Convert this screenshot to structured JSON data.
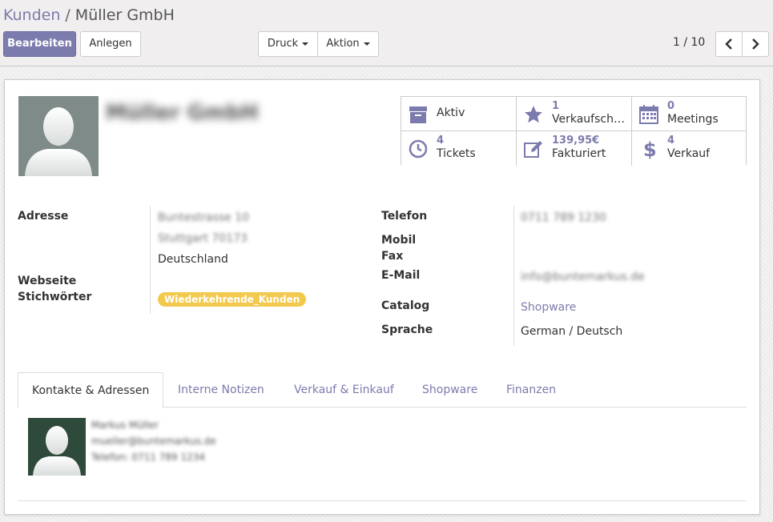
{
  "breadcrumb": {
    "parent": "Kunden",
    "separator": "/",
    "current": "Müller GmbH"
  },
  "toolbar": {
    "edit_label": "Bearbeiten",
    "create_label": "Anlegen",
    "print_label": "Druck",
    "action_label": "Aktion"
  },
  "pager": {
    "value": "1 / 10",
    "prev_icon": "‹",
    "next_icon": "›"
  },
  "partner": {
    "name": "Müller GmbH"
  },
  "stat_buttons": {
    "active": {
      "label": "Aktiv",
      "icon": "archive-icon"
    },
    "purchases": {
      "count": "1",
      "label": "Verkaufschancen",
      "icon": "star-icon"
    },
    "meetings": {
      "count": "0",
      "label": "Meetings",
      "icon": "calendar-icon"
    },
    "tickets": {
      "count": "4",
      "label": "Tickets",
      "icon": "clock-icon"
    },
    "invoiced": {
      "amount": "139,95€",
      "label": "Fakturiert",
      "icon": "edit-icon"
    },
    "sales": {
      "count": "4",
      "label": "Verkauf",
      "icon": "dollar-icon"
    }
  },
  "fields_left": {
    "address_label": "Adresse",
    "street": "Buntestrasse 10",
    "city": "Stuttgart 70173",
    "country": "Deutschland",
    "website_label": "Webseite",
    "tags_label": "Stichwörter",
    "tag": "Wiederkehrende_Kunden"
  },
  "fields_right": {
    "phone_label": "Telefon",
    "phone": "0711 789 1230",
    "mobile_label": "Mobil",
    "fax_label": "Fax",
    "email_label": "E-Mail",
    "email": "info@buntemarkus.de",
    "catalog_label": "Catalog",
    "catalog": "Shopware",
    "language_label": "Sprache",
    "language": "German / Deutsch"
  },
  "tabs": [
    {
      "label": "Kontakte & Adressen"
    },
    {
      "label": "Interne Notizen"
    },
    {
      "label": "Verkauf & Einkauf"
    },
    {
      "label": "Shopware"
    },
    {
      "label": "Finanzen"
    }
  ],
  "contact": {
    "name": "Markus Müller",
    "email": "mueller@buntemarkus.de",
    "phone": "Telefon: 0711 789 1234"
  },
  "colors": {
    "brand": "#7c7bad",
    "tag": "#f2c94c"
  }
}
